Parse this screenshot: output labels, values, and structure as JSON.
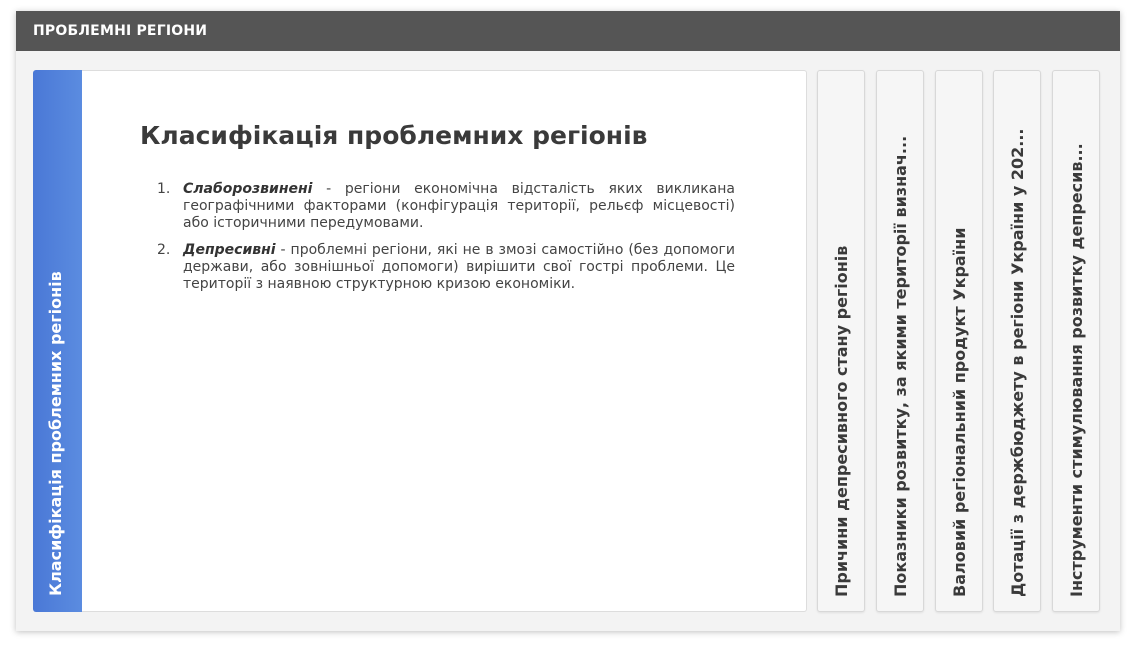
{
  "header": {
    "title": "ПРОБЛЕМНІ РЕГІОНИ"
  },
  "active_tab": {
    "label": "Класифікація проблемних регіонів"
  },
  "content": {
    "title": "Класифікація проблемних регіонів",
    "items": [
      {
        "number": "1.",
        "term": "Слаборозвинені",
        "text": " - регіони економічна відсталість яких викликана географічними факторами (конфігурація території, рельєф місцевості) або історичними передумовами."
      },
      {
        "number": "2.",
        "term": "Депресивні",
        "text": " - проблемні регіони, які не в змозі самостійно (без допомоги держави, або зовнішньої допомоги) вирішити свої гострі проблеми. Це території з наявною структурною кризою економіки."
      }
    ]
  },
  "side_tabs": [
    {
      "label": "Причини депресивного стану регіонів"
    },
    {
      "label": "Показники розвитку, за якими території визнач..."
    },
    {
      "label": "Валовий регіональний продукт України"
    },
    {
      "label": "Дотації з держбюджету в регіони України у 202..."
    },
    {
      "label": "Інструменти стимулювання розвитку депресив..."
    }
  ],
  "colors": {
    "header_bg": "#555555",
    "active_tab": "#4a78d6",
    "card_bg": "#f3f3f3"
  }
}
